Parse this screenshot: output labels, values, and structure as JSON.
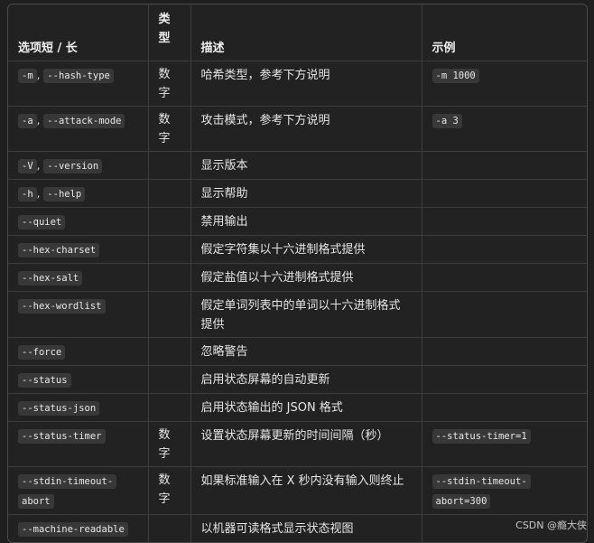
{
  "table": {
    "headers": {
      "option": "选项短 / 长",
      "type": "类型",
      "description": "描述",
      "example": "示例"
    },
    "rows": [
      {
        "short": "-m",
        "long": "--hash-type",
        "type": "数字",
        "description": "哈希类型，参考下方说明",
        "example": "-m 1000"
      },
      {
        "short": "-a",
        "long": "--attack-mode",
        "type": "数字",
        "description": "攻击模式，参考下方说明",
        "example": "-a 3"
      },
      {
        "short": "-V",
        "long": "--version",
        "type": "",
        "description": "显示版本",
        "example": ""
      },
      {
        "short": "-h",
        "long": "--help",
        "type": "",
        "description": "显示帮助",
        "example": ""
      },
      {
        "short": "",
        "long": "--quiet",
        "type": "",
        "description": "禁用输出",
        "example": ""
      },
      {
        "short": "",
        "long": "--hex-charset",
        "type": "",
        "description": "假定字符集以十六进制格式提供",
        "example": ""
      },
      {
        "short": "",
        "long": "--hex-salt",
        "type": "",
        "description": "假定盐值以十六进制格式提供",
        "example": ""
      },
      {
        "short": "",
        "long": "--hex-wordlist",
        "type": "",
        "description": "假定单词列表中的单词以十六进制格式提供",
        "example": ""
      },
      {
        "short": "",
        "long": "--force",
        "type": "",
        "description": "忽略警告",
        "example": ""
      },
      {
        "short": "",
        "long": "--status",
        "type": "",
        "description": "启用状态屏幕的自动更新",
        "example": ""
      },
      {
        "short": "",
        "long": "--status-json",
        "type": "",
        "description": "启用状态输出的 JSON 格式",
        "example": ""
      },
      {
        "short": "",
        "long": "--status-timer",
        "type": "数字",
        "description": "设置状态屏幕更新的时间间隔（秒）",
        "example": "--status-timer=1"
      },
      {
        "short": "",
        "long": "--stdin-timeout-abort",
        "type": "数字",
        "description": "如果标准输入在 X 秒内没有输入则终止",
        "example": "--stdin-timeout-abort=300"
      },
      {
        "short": "",
        "long": "--machine-readable",
        "type": "",
        "description": "以机器可读格式显示状态视图",
        "example": ""
      }
    ]
  },
  "watermark": "CSDN @瘾大侠"
}
